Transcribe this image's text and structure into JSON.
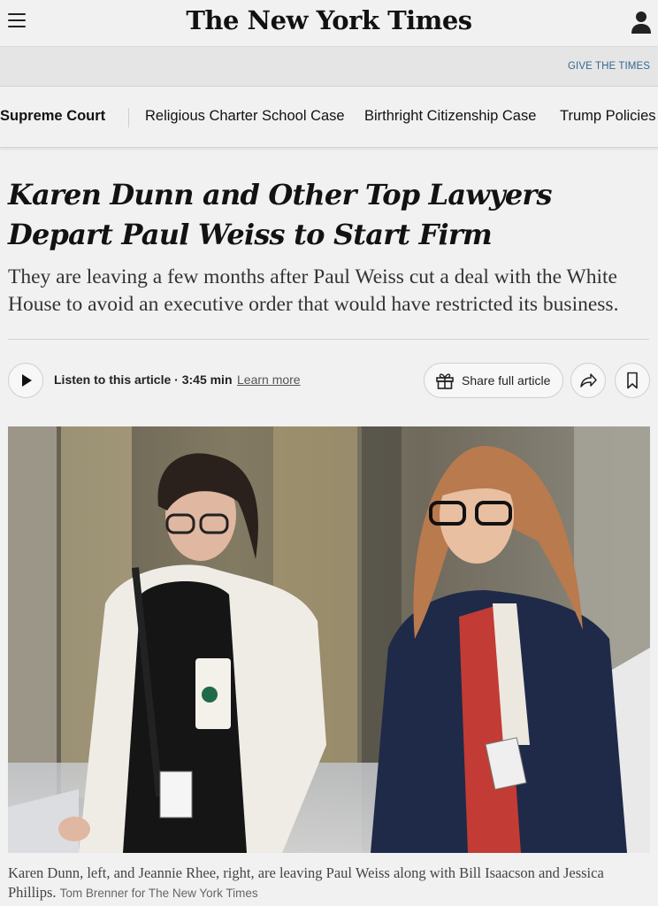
{
  "header": {
    "logo_text": "The New York Times",
    "menu_icon": "hamburger-menu-icon",
    "account_icon": "user-account-icon"
  },
  "promo": {
    "give_label": "GIVE THE TIMES"
  },
  "section_nav": {
    "items": [
      {
        "label": "Supreme Court"
      },
      {
        "label": "Religious Charter School Case"
      },
      {
        "label": "Birthright Citizenship Case"
      },
      {
        "label": "Trump Policies"
      }
    ]
  },
  "article": {
    "headline_line1": "Karen Dunn and Other Top Lawyers",
    "headline_line2": "Depart Paul Weiss to Start Firm",
    "summary": "They are leaving a few months after Paul Weiss cut a deal with the White House to avoid an executive order that would have restricted its business."
  },
  "listen_bar": {
    "listen_label": "Listen to this article",
    "duration": "3:45 min",
    "separator": " · ",
    "learn_more": "Learn more",
    "share_label": "Share full article",
    "icons": [
      "play-icon",
      "gift-icon",
      "share-arrow-icon",
      "bookmark-icon"
    ]
  },
  "photo": {
    "caption": "Karen Dunn, left, and Jeannie Rhee, right, are leaving Paul Weiss along with Bill Isaacson and Jessica Phillips.",
    "credit": "Tom Brenner for The New York Times"
  },
  "colors": {
    "page_bg": "#f1f1f1",
    "link_blue": "#326891",
    "text": "#121212"
  }
}
